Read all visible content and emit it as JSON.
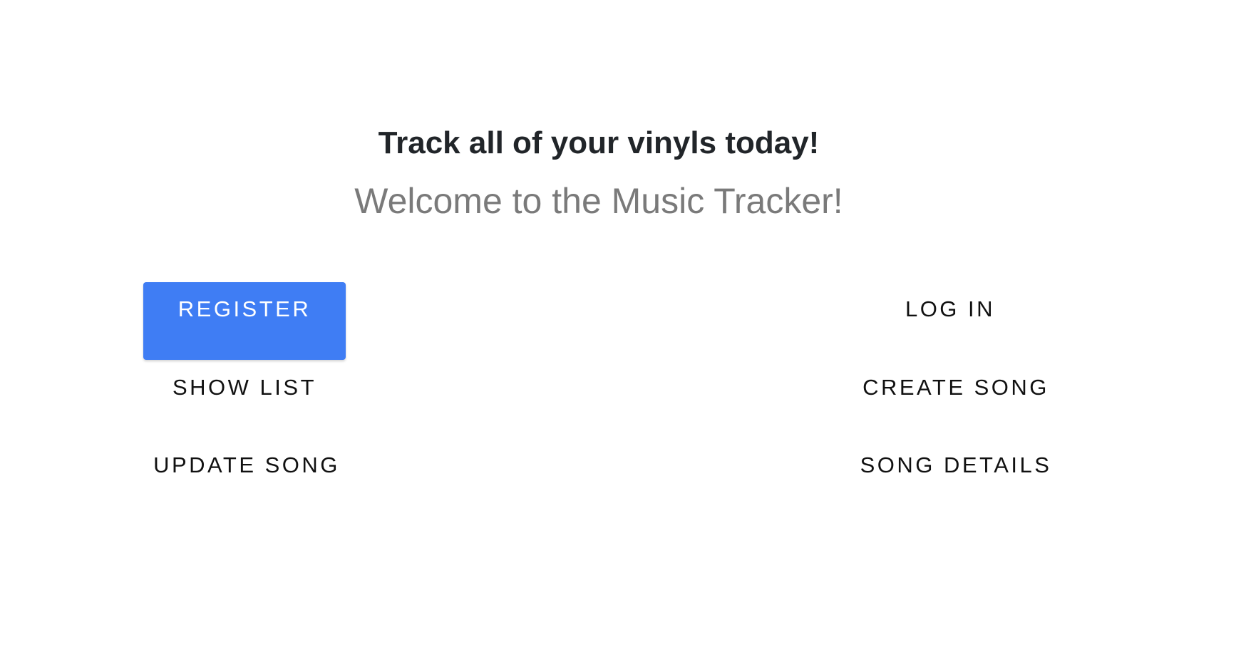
{
  "hero": {
    "title": "Track all of your vinyls today!",
    "subtitle": "Welcome to the Music Tracker!"
  },
  "actions": {
    "register": "REGISTER",
    "log_in": "LOG IN",
    "show_list": "SHOW LIST",
    "create_song": "CREATE SONG",
    "update_song": "UPDATE SONG",
    "song_details": "SONG DETAILS"
  },
  "colors": {
    "primary_button": "#3f7df4",
    "title_text": "#212529",
    "subtitle_text": "#7a7a7a",
    "button_text": "#111111"
  }
}
